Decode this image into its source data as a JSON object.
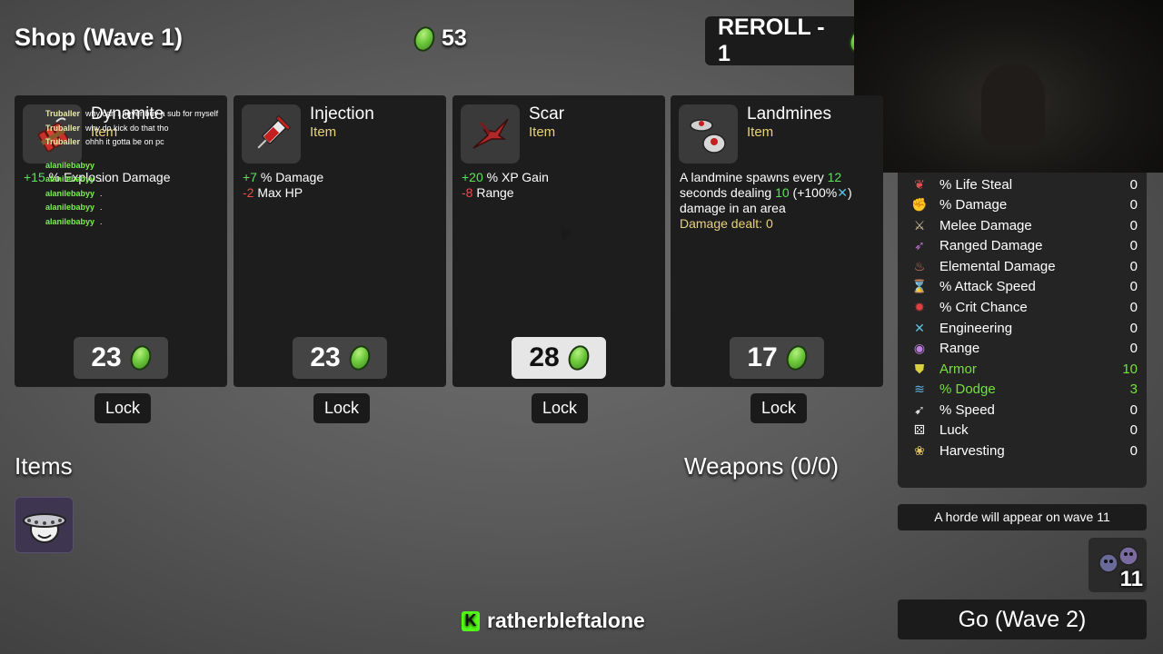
{
  "header": {
    "shop_title": "Shop (Wave 1)",
    "gold_amount": "53",
    "reroll_label": "REROLL - 1"
  },
  "shop_cards": [
    {
      "name": "Dynamite",
      "type": "Item",
      "icon": "dynamite-icon",
      "stats": [
        {
          "value": "+15",
          "label": " % Explosion Damage",
          "tone": "pos"
        }
      ],
      "price": "23",
      "lock_label": "Lock"
    },
    {
      "name": "Injection",
      "type": "Item",
      "icon": "syringe-icon",
      "stats": [
        {
          "value": "+7",
          "label": " % Damage",
          "tone": "pos"
        },
        {
          "value": "-2",
          "label": " Max HP",
          "tone": "neg"
        }
      ],
      "price": "23",
      "lock_label": "Lock"
    },
    {
      "name": "Scar",
      "type": "Item",
      "icon": "scar-icon",
      "stats": [
        {
          "value": "+20",
          "label": " % XP Gain",
          "tone": "pos"
        },
        {
          "value": "-8",
          "label": " Range",
          "tone": "neg"
        }
      ],
      "price": "28",
      "lock_label": "Lock"
    },
    {
      "name": "Landmines",
      "type": "Item",
      "icon": "landmine-icon",
      "desc_1": "A landmine spawns every ",
      "desc_num1": "12",
      "desc_2": " seconds dealing ",
      "desc_num2": "10",
      "desc_3": " (+100%",
      "desc_4": ") damage in an area",
      "damage_dealt": "Damage dealt: 0",
      "price": "17",
      "lock_label": "Lock"
    }
  ],
  "chat": [
    {
      "user": "Truballer",
      "msg": "why can I never buy a sub for myself",
      "color": "yellow"
    },
    {
      "user": "Truballer",
      "msg": "why do kick do that tho",
      "color": "yellow"
    },
    {
      "user": "Truballer",
      "msg": "ohhh it gotta be on pc",
      "color": "yellow"
    },
    {
      "user": "alanilebabyy",
      "msg": "",
      "color": "green"
    },
    {
      "user": "alanilebabyy",
      "msg": ".",
      "color": "green"
    },
    {
      "user": "alanilebabyy",
      "msg": ".",
      "color": "green"
    },
    {
      "user": "alanilebabyy",
      "msg": ".",
      "color": "green"
    },
    {
      "user": "alanilebabyy",
      "msg": ".",
      "color": "green"
    }
  ],
  "sections": {
    "items_title": "Items",
    "weapons_title": "Weapons (0/0)"
  },
  "stats": [
    {
      "label": "% Life Steal",
      "value": "0",
      "icon": "life-steal-icon",
      "color": "#e05050"
    },
    {
      "label": "% Damage",
      "value": "0",
      "icon": "damage-icon",
      "color": "#e06060"
    },
    {
      "label": "Melee Damage",
      "value": "0",
      "icon": "sword-icon",
      "color": "#d8c8a0"
    },
    {
      "label": "Ranged Damage",
      "value": "0",
      "icon": "bow-icon",
      "color": "#c070d0"
    },
    {
      "label": "Elemental Damage",
      "value": "0",
      "icon": "flame-icon",
      "color": "#e08060"
    },
    {
      "label": "% Attack Speed",
      "value": "0",
      "icon": "hourglass-icon",
      "color": "#d0d0d0"
    },
    {
      "label": "% Crit Chance",
      "value": "0",
      "icon": "crit-icon",
      "color": "#e04040"
    },
    {
      "label": "Engineering",
      "value": "0",
      "icon": "wrench-icon",
      "color": "#60c0e0"
    },
    {
      "label": "Range",
      "value": "0",
      "icon": "range-icon",
      "color": "#c080e0"
    },
    {
      "label": "Armor",
      "value": "10",
      "icon": "shield-icon",
      "color": "#d8d040",
      "highlight": true
    },
    {
      "label": "% Dodge",
      "value": "3",
      "icon": "dodge-icon",
      "color": "#60b0e0",
      "highlight": true
    },
    {
      "label": "% Speed",
      "value": "0",
      "icon": "boot-icon",
      "color": "#e0e0e0"
    },
    {
      "label": "Luck",
      "value": "0",
      "icon": "dice-icon",
      "color": "#f0f0f0"
    },
    {
      "label": "Harvesting",
      "value": "0",
      "icon": "wheat-icon",
      "color": "#e0c060"
    }
  ],
  "horde_text": "A horde will appear on wave 11",
  "enemy_count": "11",
  "go_label": "Go (Wave 2)",
  "channel_name": "ratherbleftalone",
  "colors": {
    "positive": "#5ee05e",
    "negative": "#f04a4a",
    "item_type": "#e8d27a",
    "highlight_stat": "#76e03e",
    "kick_green": "#53fc18"
  }
}
